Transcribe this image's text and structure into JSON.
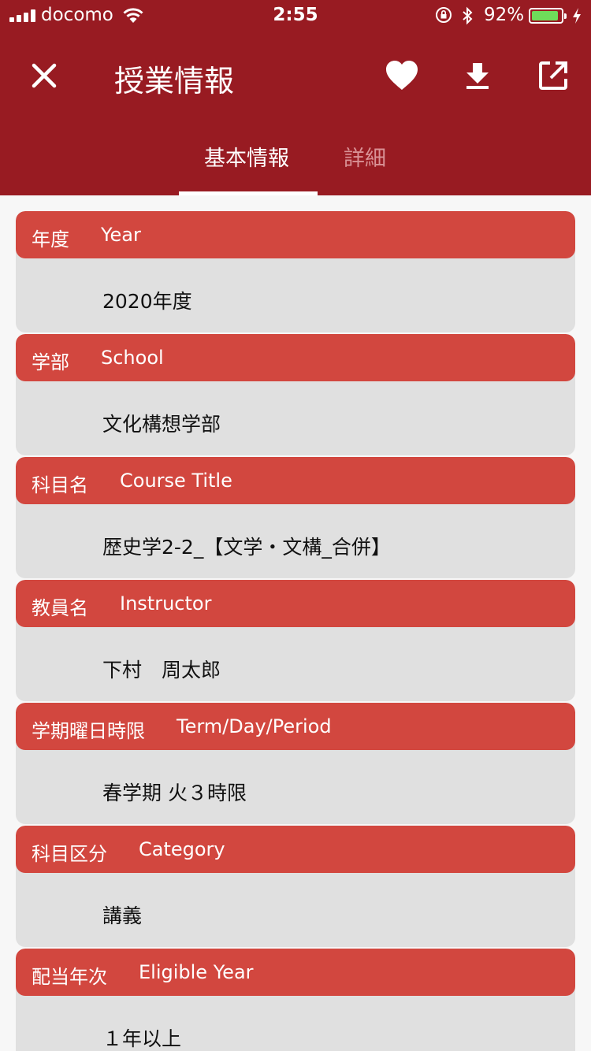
{
  "status_bar": {
    "carrier": "docomo",
    "time": "2:55",
    "battery_percent": "92%",
    "battery_level": 0.92,
    "icons": [
      "signal-icon",
      "wifi-icon",
      "orientation-lock-icon",
      "bluetooth-icon",
      "battery-icon",
      "charging-icon"
    ]
  },
  "app_bar": {
    "title": "授業情報",
    "actions": [
      "close-icon",
      "heart-icon",
      "download-icon",
      "open-external-icon"
    ]
  },
  "tabs": [
    {
      "label": "基本情報",
      "active": true
    },
    {
      "label": "詳細",
      "active": false
    }
  ],
  "sections": [
    {
      "label_ja": "年度",
      "label_en": "Year",
      "value": "2020年度"
    },
    {
      "label_ja": "学部",
      "label_en": "School",
      "value": "文化構想学部"
    },
    {
      "label_ja": "科目名",
      "label_en": "Course Title",
      "value": "歴史学2-2_【文学・文構_合併】"
    },
    {
      "label_ja": "教員名",
      "label_en": "Instructor",
      "value": "下村　周太郎"
    },
    {
      "label_ja": "学期曜日時限",
      "label_en": "Term/Day/Period",
      "value": "春学期  火３時限"
    },
    {
      "label_ja": "科目区分",
      "label_en": "Category",
      "value": "講義"
    },
    {
      "label_ja": "配当年次",
      "label_en": "Eligible Year",
      "value": "１年以上"
    }
  ],
  "colors": {
    "app_bar": "#981b22",
    "section_header": "#d2473f",
    "section_body": "#e0e0e0",
    "tab_inactive": "#d99296"
  }
}
